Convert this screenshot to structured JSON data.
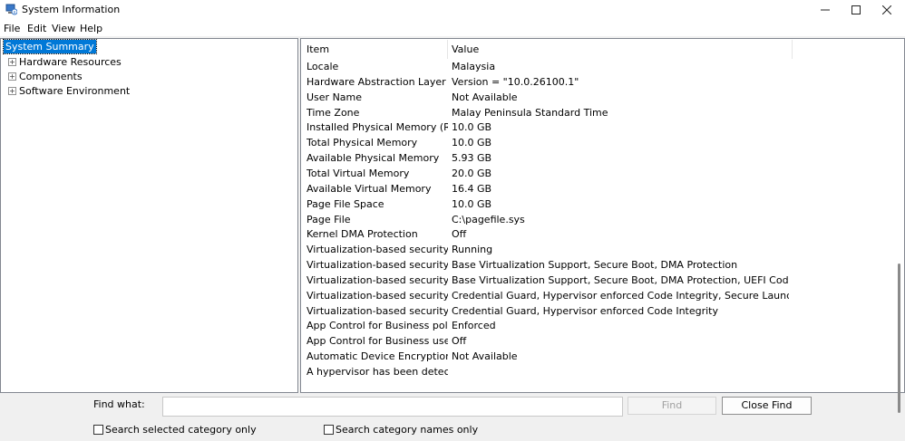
{
  "window": {
    "title": "System Information"
  },
  "menu": [
    "File",
    "Edit",
    "View",
    "Help"
  ],
  "tree": {
    "selected": "System Summary",
    "children": [
      "Hardware Resources",
      "Components",
      "Software Environment"
    ]
  },
  "list": {
    "columns": [
      "Item",
      "Value"
    ],
    "rows": [
      {
        "item": "Locale",
        "value": "Malaysia"
      },
      {
        "item": "Hardware Abstraction Layer",
        "value": "Version = \"10.0.26100.1\""
      },
      {
        "item": "User Name",
        "value": "Not Available"
      },
      {
        "item": "Time Zone",
        "value": "Malay Peninsula Standard Time"
      },
      {
        "item": "Installed Physical Memory (RAM)",
        "value": "10.0 GB"
      },
      {
        "item": "Total Physical Memory",
        "value": "10.0 GB"
      },
      {
        "item": "Available Physical Memory",
        "value": "5.93 GB"
      },
      {
        "item": "Total Virtual Memory",
        "value": "20.0 GB"
      },
      {
        "item": "Available Virtual Memory",
        "value": "16.4 GB"
      },
      {
        "item": "Page File Space",
        "value": "10.0 GB"
      },
      {
        "item": "Page File",
        "value": "C:\\pagefile.sys"
      },
      {
        "item": "Kernel DMA Protection",
        "value": "Off"
      },
      {
        "item": "Virtualization-based security",
        "value": "Running"
      },
      {
        "item": "Virtualization-based security Re...",
        "value": "Base Virtualization Support, Secure Boot, DMA Protection"
      },
      {
        "item": "Virtualization-based security Av...",
        "value": "Base Virtualization Support, Secure Boot, DMA Protection, UEFI Code Readonl..."
      },
      {
        "item": "Virtualization-based security Se...",
        "value": "Credential Guard, Hypervisor enforced Code Integrity, Secure Launch, Kernel-..."
      },
      {
        "item": "Virtualization-based security Se...",
        "value": "Credential Guard, Hypervisor enforced Code Integrity"
      },
      {
        "item": "App Control for Business policy",
        "value": "Enforced"
      },
      {
        "item": "App Control for Business user ...",
        "value": "Off"
      },
      {
        "item": "Automatic Device Encryption Su...",
        "value": "Not Available"
      },
      {
        "item": "A hypervisor has been detecte...",
        "value": ""
      }
    ]
  },
  "find": {
    "label": "Find what:",
    "value": "",
    "find_button": "Find",
    "close_button": "Close Find",
    "check_selected": "Search selected category only",
    "check_names": "Search category names only"
  },
  "colors": {
    "selection": "#0078d7"
  },
  "icons": [
    "system-information-app-icon",
    "minimize-icon",
    "maximize-icon",
    "close-icon",
    "expand-plus-icon"
  ]
}
